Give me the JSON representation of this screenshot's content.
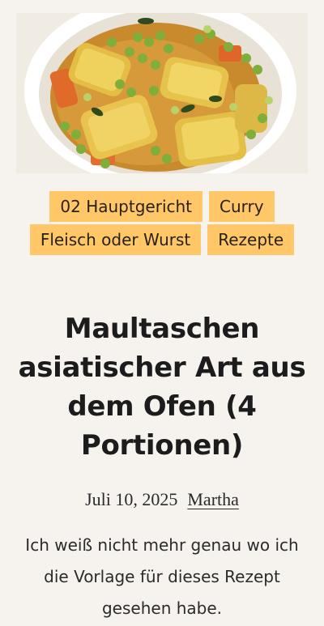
{
  "hero": {
    "image_alt": "Maultaschen asiatischer Art aus dem Ofen"
  },
  "tags": [
    {
      "label": "02 Hauptgericht"
    },
    {
      "label": "Curry"
    },
    {
      "label": "Fleisch oder Wurst"
    },
    {
      "label": "Rezepte"
    }
  ],
  "post": {
    "title": "Maultaschen asiatischer Art aus dem Ofen (4 Portionen)",
    "date": "Juli 10, 2025",
    "author": "Martha",
    "excerpt": "Ich weiß nicht mehr genau wo ich die Vorlage für dieses Rezept gesehen habe."
  },
  "colors": {
    "background": "#f6f3ee",
    "tag_background": "#ffc768",
    "text": "#1f1f1f"
  }
}
